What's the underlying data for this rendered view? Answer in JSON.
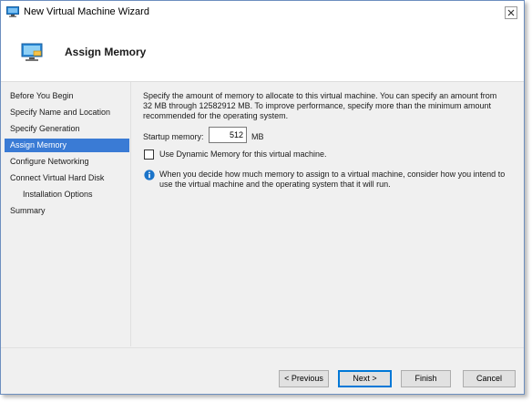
{
  "window": {
    "title": "New Virtual Machine Wizard",
    "title_icon": "hyper-v-icon",
    "close_icon": "close-icon"
  },
  "header": {
    "title": "Assign Memory",
    "icon": "memory-icon"
  },
  "sidebar": {
    "items": [
      {
        "label": "Before You Begin",
        "active": false,
        "sub": false
      },
      {
        "label": "Specify Name and Location",
        "active": false,
        "sub": false
      },
      {
        "label": "Specify Generation",
        "active": false,
        "sub": false
      },
      {
        "label": "Assign Memory",
        "active": true,
        "sub": false
      },
      {
        "label": "Configure Networking",
        "active": false,
        "sub": false
      },
      {
        "label": "Connect Virtual Hard Disk",
        "active": false,
        "sub": false
      },
      {
        "label": "Installation Options",
        "active": false,
        "sub": true
      },
      {
        "label": "Summary",
        "active": false,
        "sub": false
      }
    ]
  },
  "main": {
    "intro": "Specify the amount of memory to allocate to this virtual machine. You can specify an amount from 32 MB through 12582912 MB. To improve performance, specify more than the minimum amount recommended for the operating system.",
    "startup_label": "Startup memory:",
    "startup_value": "512",
    "startup_unit": "MB",
    "dynamic_memory_label": "Use Dynamic Memory for this virtual machine.",
    "dynamic_memory_checked": false,
    "info_text": "When you decide how much memory to assign to a virtual machine, consider how you intend to use the virtual machine and the operating system that it will run."
  },
  "footer": {
    "previous": "< Previous",
    "next": "Next >",
    "finish": "Finish",
    "cancel": "Cancel"
  },
  "colors": {
    "accent": "#3a7bd5",
    "info": "#1a73c9"
  }
}
